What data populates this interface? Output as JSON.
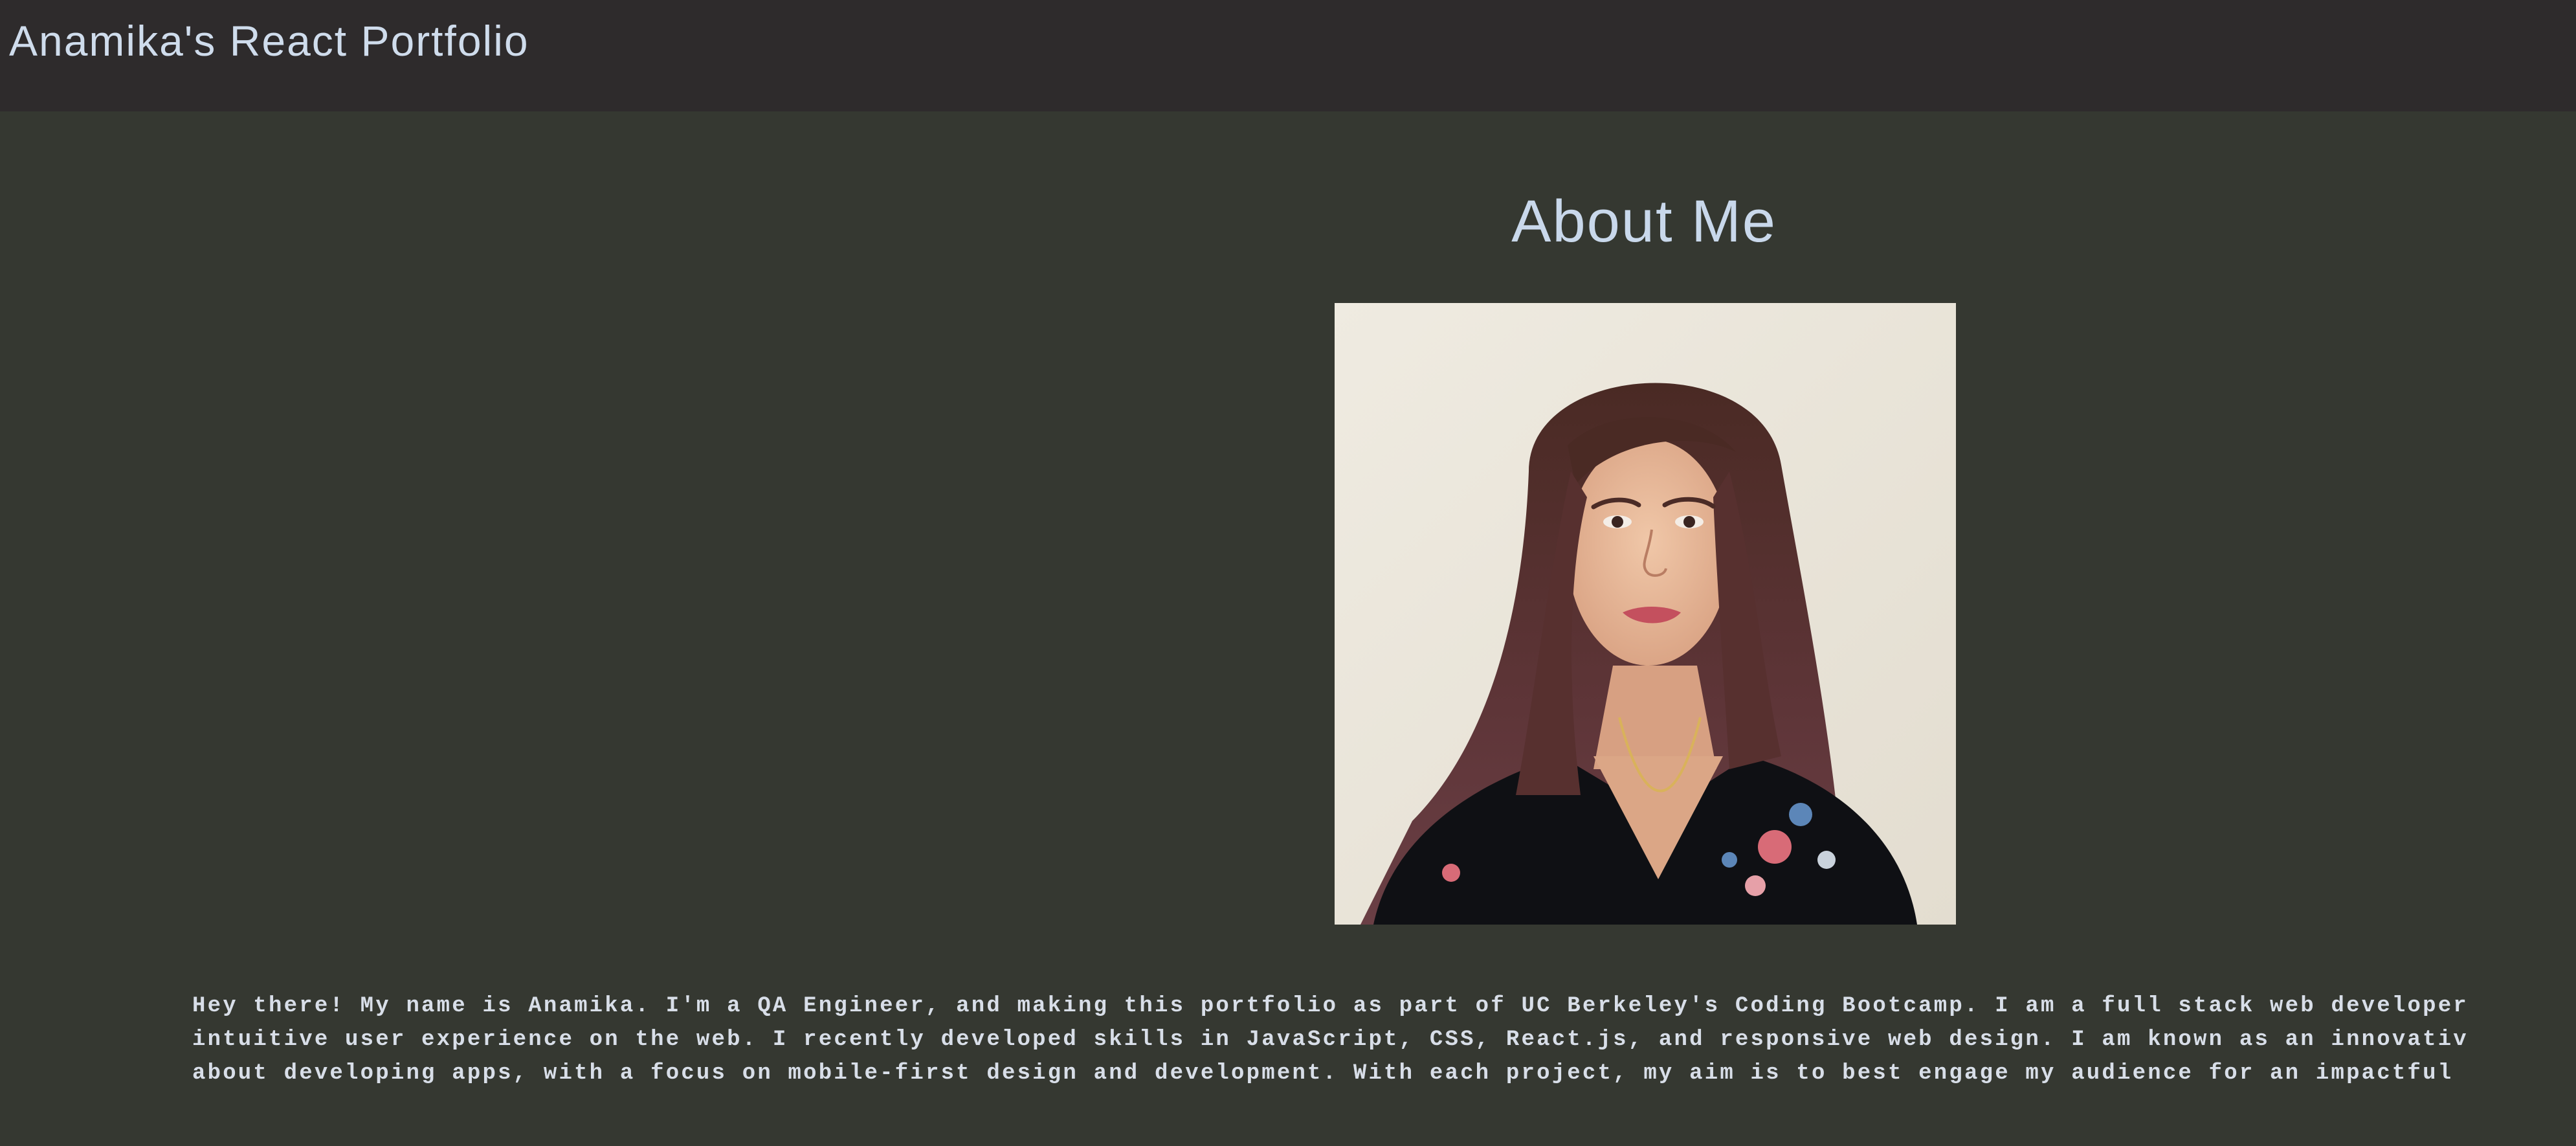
{
  "header": {
    "title": "Anamika's React Portfolio"
  },
  "about": {
    "heading": "About Me",
    "bio_lines": [
      "Hey there! My name is Anamika. I'm a QA Engineer, and making this portfolio as part of UC Berkeley's Coding Bootcamp. I am a full stack web developer",
      "intuitive user experience on the web. I recently developed skills in JavaScript, CSS, React.js, and responsive web design. I am known as an innovativ",
      "about developing apps, with a focus on mobile-first design and development. With each project, my aim is to best engage my audience for an impactful"
    ]
  },
  "colors": {
    "header_background": "#2e2b2c",
    "page_background": "#353831",
    "heading_text": "#c9d8eb",
    "body_text": "#d8dee8"
  }
}
